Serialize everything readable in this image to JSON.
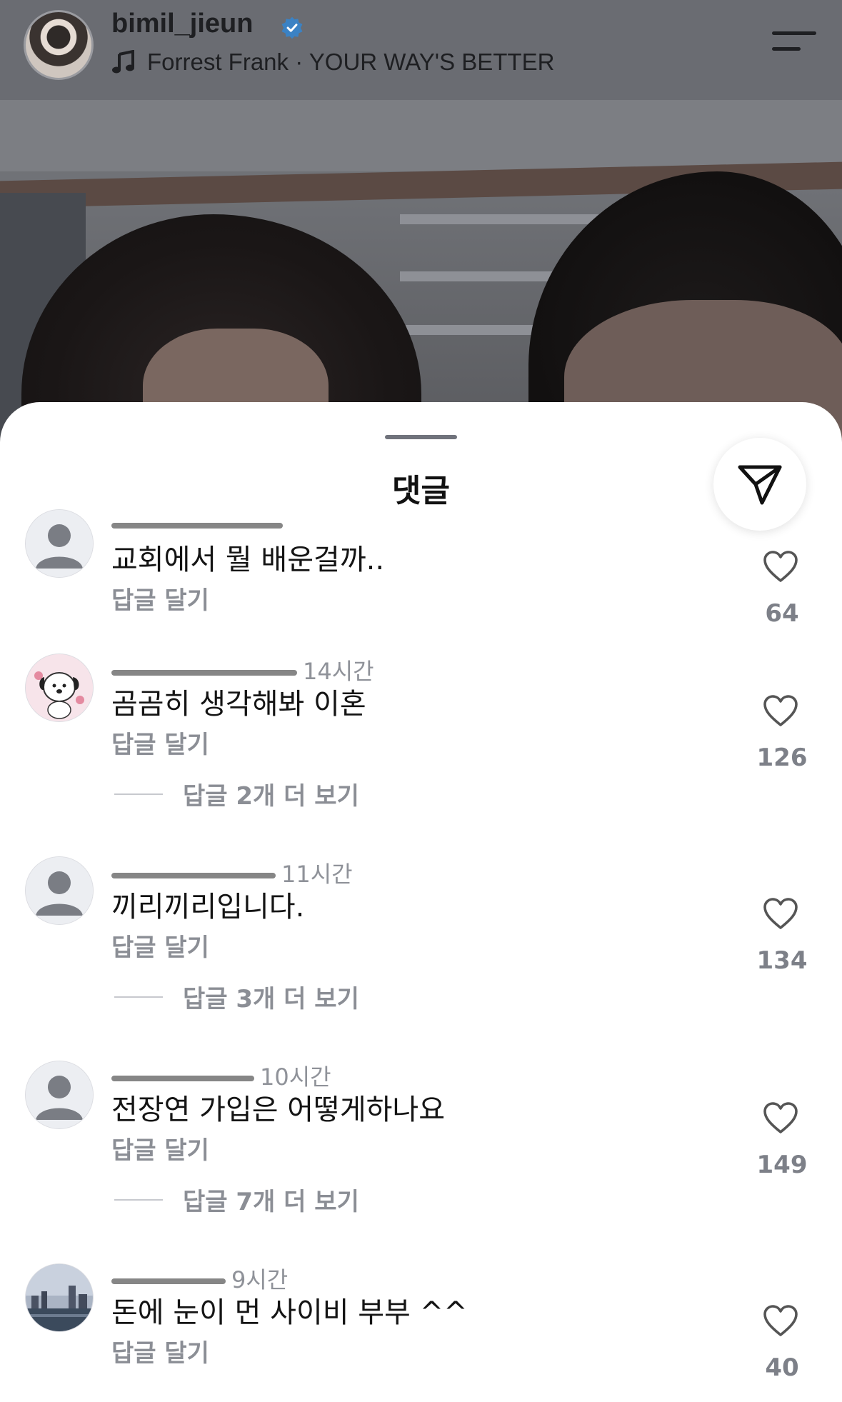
{
  "header": {
    "username": "bimil_jieun",
    "music": "Forrest Frank · YOUR WAY'S BETTER"
  },
  "sheet": {
    "title": "댓글"
  },
  "comments": [
    {
      "user_meta": "",
      "text": "교회에서 뭘 배운걸까..",
      "reply_label": "답글 달기",
      "more_replies": "",
      "likes": "64"
    },
    {
      "user_meta": "14시간",
      "text": "곰곰히 생각해봐 이혼",
      "reply_label": "답글 달기",
      "more_replies": "답글 2개 더 보기",
      "likes": "126"
    },
    {
      "user_meta": "11시간",
      "text": "끼리끼리입니다.",
      "reply_label": "답글 달기",
      "more_replies": "답글 3개 더 보기",
      "likes": "134"
    },
    {
      "user_meta": "10시간",
      "text": "전장연 가입은 어떻게하나요",
      "reply_label": "답글 달기",
      "more_replies": "답글 7개 더 보기",
      "likes": "149"
    },
    {
      "user_meta": "9시간",
      "text": "돈에 눈이 먼 사이비 부부 ^^",
      "reply_label": "답글 달기",
      "more_replies": "",
      "likes": "40"
    }
  ],
  "colors": {
    "verified": "#3b82c4",
    "sheet_bg": "#ffffff",
    "secondary_text": "#8b8e95"
  }
}
